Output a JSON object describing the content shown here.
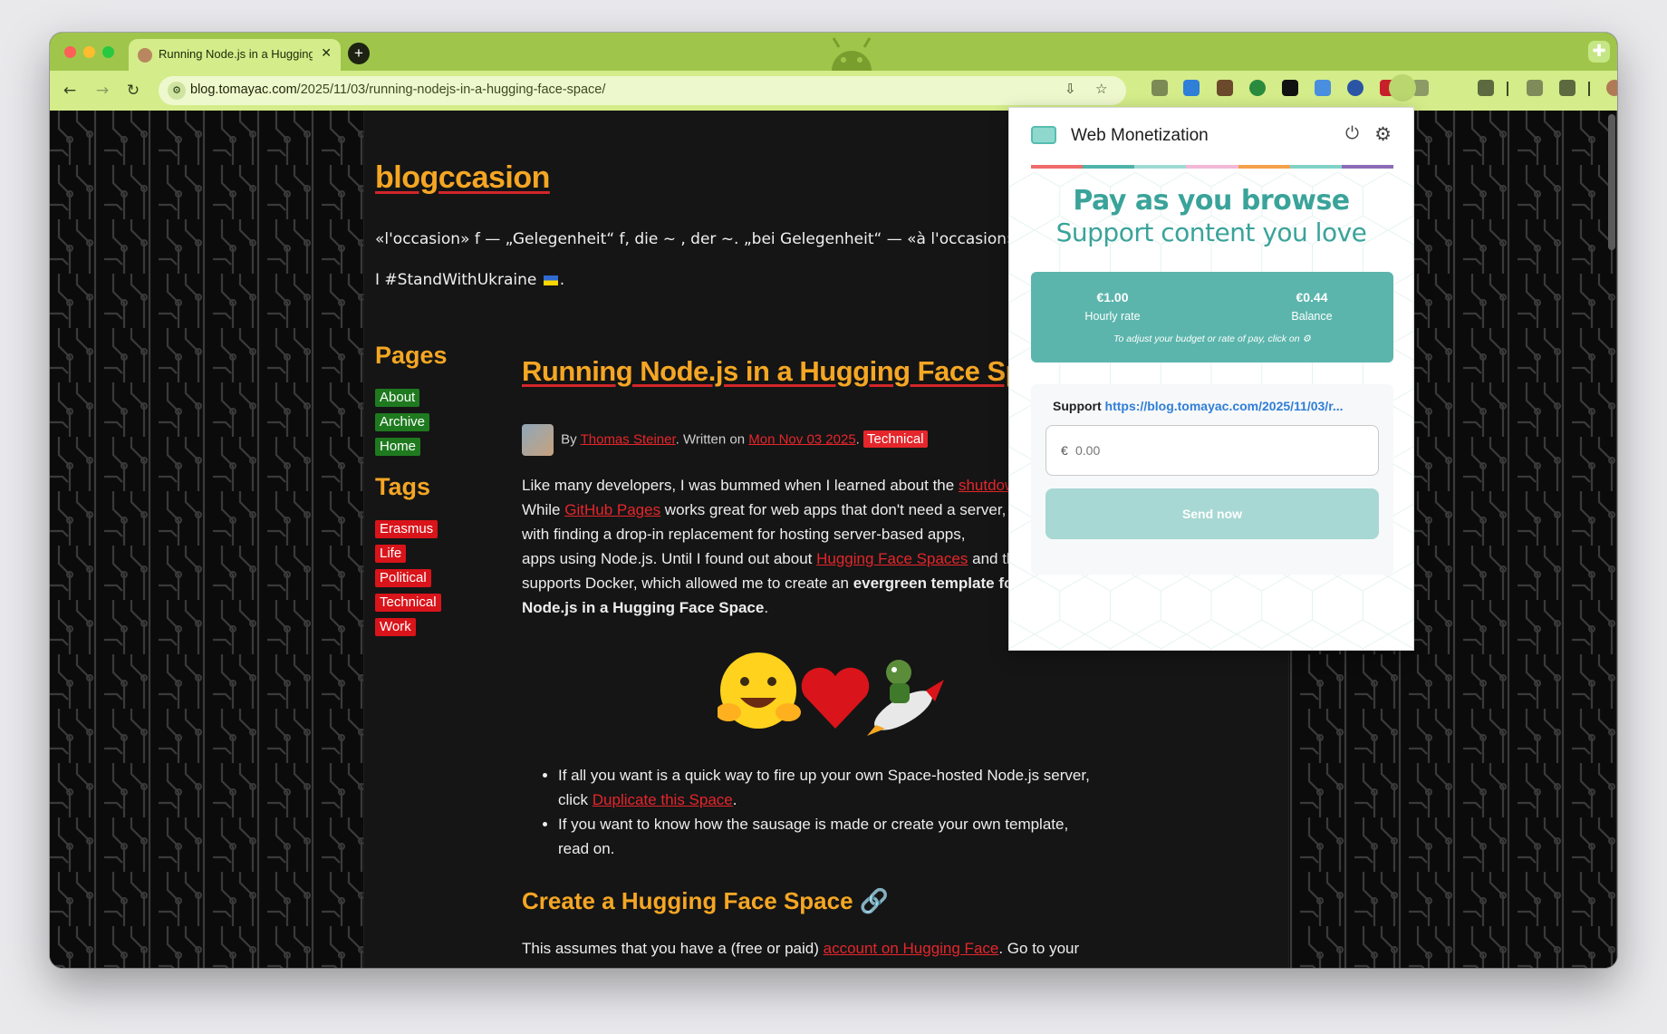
{
  "browser": {
    "tab_title": "Running Node.js in a Hugging Face Space",
    "tab_close": "✕",
    "new_tab": "+",
    "url_host": "blog.tomayac.com",
    "url_path": "/2025/11/03/running-nodejs-in-a-hugging-face-space/",
    "back_icon": "←",
    "forward_icon": "→",
    "reload_icon": "↻",
    "menu_icon": "⋮"
  },
  "blog": {
    "site_title": "blogccasion",
    "tagline": "«l'occasion» f — „Gelegenheit“ f, die ~ , der ~. „bei Gelegenheit“ — «à l'occasion»",
    "ukraine_prefix": "I #StandWithUkraine",
    "ukraine_suffix": ".",
    "pages_heading": "Pages",
    "pages": [
      "About",
      "Archive",
      "Home"
    ],
    "tags_heading": "Tags",
    "tags": [
      "Erasmus",
      "Life",
      "Political",
      "Technical",
      "Work"
    ]
  },
  "post": {
    "title": "Running Node.js in a Hugging Face Space",
    "by": "By",
    "author": "Thomas Steiner",
    "written_on": ". Written on",
    "date": "Mon Nov 03 2025",
    "category": "Technical",
    "p1_a": "Like many developers, I was bummed when I learned about the ",
    "p1_link": "shutdown of Glitch",
    "p2_a": "While ",
    "p2_link": "GitHub Pages",
    "p2_b": " works great for web apps that don't need a server,",
    "p3": "with finding a drop-in replacement for hosting server-based apps,",
    "p4_a": "apps using Node.js. Until I found out about ",
    "p4_link": "Hugging Face Spaces",
    "p4_b": " and that it",
    "p5_a": "supports Docker, which allowed me to create an ",
    "p5_bold": "evergreen template for running",
    "p6_bold": "Node.js in a Hugging Face Space",
    "p6_b": ".",
    "bullet1_a": "If all you want is a quick way to fire up your own Space-hosted Node.js server,",
    "bullet1_b": "click ",
    "bullet1_link": "Duplicate this Space",
    "bullet1_c": ".",
    "bullet2_a": "If you want to know how the sausage is made or create your own template,",
    "bullet2_b": "read on.",
    "h2": "Create a Hugging Face Space 🔗",
    "last_a": "This assumes that you have a (free or paid) ",
    "last_link": "account on Hugging Face",
    "last_b": ". Go to your"
  },
  "popup": {
    "title": "Web Monetization",
    "power_icon": "⏻",
    "gear_icon": "⚙",
    "headline": "Pay as you browse",
    "subheadline": "Support content you love",
    "hourly_value": "€1.00",
    "hourly_label": "Hourly rate",
    "balance_value": "€0.44",
    "balance_label": "Balance",
    "note": "To adjust your budget or rate of pay, click on ⚙",
    "support_label": "Support",
    "support_url": "https://blog.tomayac.com/2025/11/03/r...",
    "currency": "€",
    "amount_placeholder": "0.00",
    "send_label": "Send now"
  },
  "colors": {
    "chrome_green": "#9fc64b",
    "accent_orange": "#f5a623",
    "link_red": "#e5262b",
    "teal": "#5bb5ac"
  }
}
